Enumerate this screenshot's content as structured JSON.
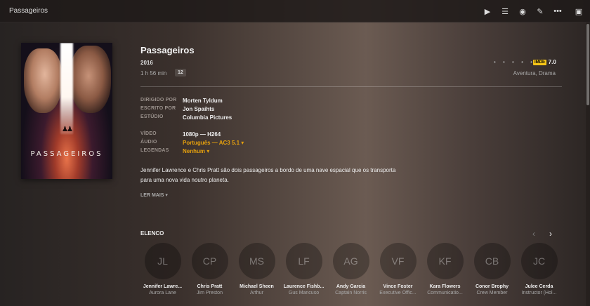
{
  "app": {
    "title": "Passageiros"
  },
  "toolbar": {
    "play": "▶",
    "queue": "☰",
    "watched": "◉",
    "edit": "✎",
    "more": "•••",
    "image": "▣"
  },
  "movie": {
    "poster_title": "PASSAGEIROS",
    "title": "Passageiros",
    "year": "2016",
    "duration": "1 h 56 min",
    "content_rating": "12",
    "rating_dots": "• • • • •",
    "imdb_logo": "IMDb",
    "imdb_score": "7.0",
    "genres": "Aventura, Drama",
    "credits": {
      "directed_label": "DIRIGIDO POR",
      "directed_value": "Morten Tyldum",
      "written_label": "ESCRITO POR",
      "written_value": "Jon Spaihts",
      "studio_label": "ESTÚDIO",
      "studio_value": "Columbia Pictures"
    },
    "media": {
      "video_label": "VÍDEO",
      "video_value": "1080p — H264",
      "audio_label": "ÁUDIO",
      "audio_value": "Português — AC3 5.1 ▾",
      "subs_label": "LEGENDAS",
      "subs_value": "Nenhum ▾"
    },
    "summary": "Jennifer Lawrence e Chris Pratt são dois passageiros a bordo de uma nave espacial que os transporta para uma nova vida noutro planeta.",
    "read_more": "LER MAIS ▾"
  },
  "cast_section": {
    "heading": "ELENCO",
    "prev": "‹",
    "next": "›",
    "members": [
      {
        "initials": "JL",
        "name": "Jennifer Lawre...",
        "role": "Aurora Lane"
      },
      {
        "initials": "CP",
        "name": "Chris Pratt",
        "role": "Jim Preston"
      },
      {
        "initials": "MS",
        "name": "Michael Sheen",
        "role": "Arthur"
      },
      {
        "initials": "LF",
        "name": "Laurence Fishb...",
        "role": "Gus Mancuso"
      },
      {
        "initials": "AG",
        "name": "Andy Garcia",
        "role": "Captain Norris"
      },
      {
        "initials": "VF",
        "name": "Vince Foster",
        "role": "Executive Offic..."
      },
      {
        "initials": "KF",
        "name": "Kara Flowers",
        "role": "Communicatio..."
      },
      {
        "initials": "CB",
        "name": "Conor Brophy",
        "role": "Crew Member"
      },
      {
        "initials": "JC",
        "name": "Julee Cerda",
        "role": "Instructor (Hol..."
      }
    ]
  },
  "colors": {
    "accent": "#e5a00d",
    "imdb": "#f5c518"
  }
}
